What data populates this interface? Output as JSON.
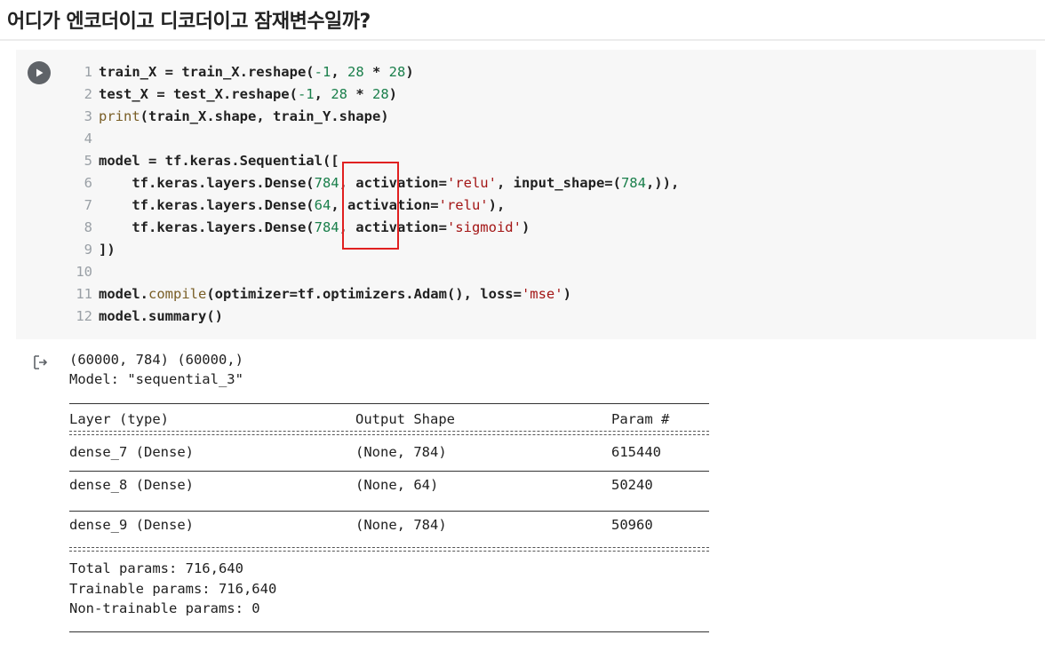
{
  "heading": "어디가 엔코더이고 디코더이고 잠재변수일까?",
  "code_cell": {
    "run_button_icon": "play-icon",
    "lines": [
      {
        "n": "1",
        "tokens": [
          [
            "default",
            "train_X = train_X.reshape("
          ],
          [
            "number",
            "-1"
          ],
          [
            "default",
            ", "
          ],
          [
            "number",
            "28"
          ],
          [
            "default",
            " * "
          ],
          [
            "number",
            "28"
          ],
          [
            "default",
            ")"
          ]
        ]
      },
      {
        "n": "2",
        "tokens": [
          [
            "default",
            "test_X = test_X.reshape("
          ],
          [
            "number",
            "-1"
          ],
          [
            "default",
            ", "
          ],
          [
            "number",
            "28"
          ],
          [
            "default",
            " * "
          ],
          [
            "number",
            "28"
          ],
          [
            "default",
            ")"
          ]
        ]
      },
      {
        "n": "3",
        "tokens": [
          [
            "builtin",
            "print"
          ],
          [
            "default",
            "(train_X.shape, train_Y.shape)"
          ]
        ]
      },
      {
        "n": "4",
        "tokens": []
      },
      {
        "n": "5",
        "tokens": [
          [
            "default",
            "model = tf.keras.Sequential(["
          ]
        ]
      },
      {
        "n": "6",
        "tokens": [
          [
            "default",
            "    tf.keras.layers.Dense("
          ],
          [
            "number",
            "784"
          ],
          [
            "default",
            ", activation="
          ],
          [
            "string",
            "'relu'"
          ],
          [
            "default",
            ", input_shape=("
          ],
          [
            "number",
            "784"
          ],
          [
            "default",
            ",)),"
          ]
        ]
      },
      {
        "n": "7",
        "tokens": [
          [
            "default",
            "    tf.keras.layers.Dense("
          ],
          [
            "number",
            "64"
          ],
          [
            "default",
            ", activation="
          ],
          [
            "string",
            "'relu'"
          ],
          [
            "default",
            "),"
          ]
        ]
      },
      {
        "n": "8",
        "tokens": [
          [
            "default",
            "    tf.keras.layers.Dense("
          ],
          [
            "number",
            "784"
          ],
          [
            "default",
            ", activation="
          ],
          [
            "string",
            "'sigmoid'"
          ],
          [
            "default",
            ")"
          ]
        ]
      },
      {
        "n": "9",
        "tokens": [
          [
            "default",
            "])"
          ]
        ]
      },
      {
        "n": "10",
        "tokens": []
      },
      {
        "n": "11",
        "tokens": [
          [
            "default",
            "model."
          ],
          [
            "builtin",
            "compile"
          ],
          [
            "default",
            "(optimizer=tf.optimizers.Adam(), loss="
          ],
          [
            "string",
            "'mse'"
          ],
          [
            "default",
            ")"
          ]
        ]
      },
      {
        "n": "12",
        "tokens": [
          [
            "default",
            "model.summary()"
          ]
        ]
      }
    ]
  },
  "output": {
    "icon": "output-arrow-icon",
    "shapes_line": "(60000, 784) (60000,)",
    "model_line": "Model: \"sequential_3\"",
    "summary": {
      "headers": [
        "Layer (type)",
        "Output Shape",
        "Param #"
      ],
      "rows": [
        [
          "dense_7 (Dense)",
          "(None, 784)",
          "615440"
        ],
        [
          "dense_8 (Dense)",
          "(None, 64)",
          "50240"
        ],
        [
          "dense_9 (Dense)",
          "(None, 784)",
          "50960"
        ]
      ],
      "total_params": "Total params: 716,640",
      "trainable_params": "Trainable params: 716,640",
      "non_trainable_params": "Non-trainable params: 0"
    }
  },
  "colors": {
    "highlight_box": "#e02020",
    "number": "#1a7f4b",
    "string": "#a31515",
    "builtin": "#795e26"
  }
}
